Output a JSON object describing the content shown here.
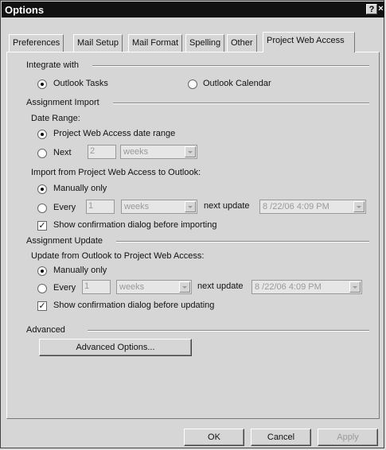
{
  "window": {
    "title": "Options",
    "help_label": "?",
    "close_label": "×"
  },
  "tabs": [
    {
      "label": "Preferences",
      "active": false
    },
    {
      "label": "Mail Setup",
      "active": false
    },
    {
      "label": "Mail Format",
      "active": false
    },
    {
      "label": "Spelling",
      "active": false
    },
    {
      "label": "Other",
      "active": false
    },
    {
      "label": "Project Web Access",
      "active": true
    }
  ],
  "integrate": {
    "heading": "Integrate with",
    "tasks_label": "Outlook Tasks",
    "calendar_label": "Outlook Calendar",
    "selected": "tasks"
  },
  "assignment_import": {
    "heading": "Assignment Import",
    "date_range": {
      "label": "Date Range:",
      "option_pwa": "Project Web Access date range",
      "option_next": "Next",
      "next_value": "2",
      "next_unit": "weeks",
      "selected": "pwa"
    },
    "import_label": "Import from Project Web Access to Outlook:",
    "manually_label": "Manually only",
    "every_label": "Every",
    "every_value": "1",
    "every_unit": "weeks",
    "next_update_label": "next update",
    "next_update_value": "8 /22/06  4:09 PM",
    "selected": "manually",
    "confirm_label": "Show confirmation dialog before importing",
    "confirm_checked": true
  },
  "assignment_update": {
    "heading": "Assignment Update",
    "update_label": "Update from Outlook to Project Web Access:",
    "manually_label": "Manually only",
    "every_label": "Every",
    "every_value": "1",
    "every_unit": "weeks",
    "next_update_label": "next update",
    "next_update_value": "8 /22/06  4:09 PM",
    "selected": "manually",
    "confirm_label": "Show confirmation dialog before updating",
    "confirm_checked": true
  },
  "advanced": {
    "heading": "Advanced",
    "button_label": "Advanced Options..."
  },
  "footer": {
    "ok_label": "OK",
    "cancel_label": "Cancel",
    "apply_label": "Apply"
  }
}
